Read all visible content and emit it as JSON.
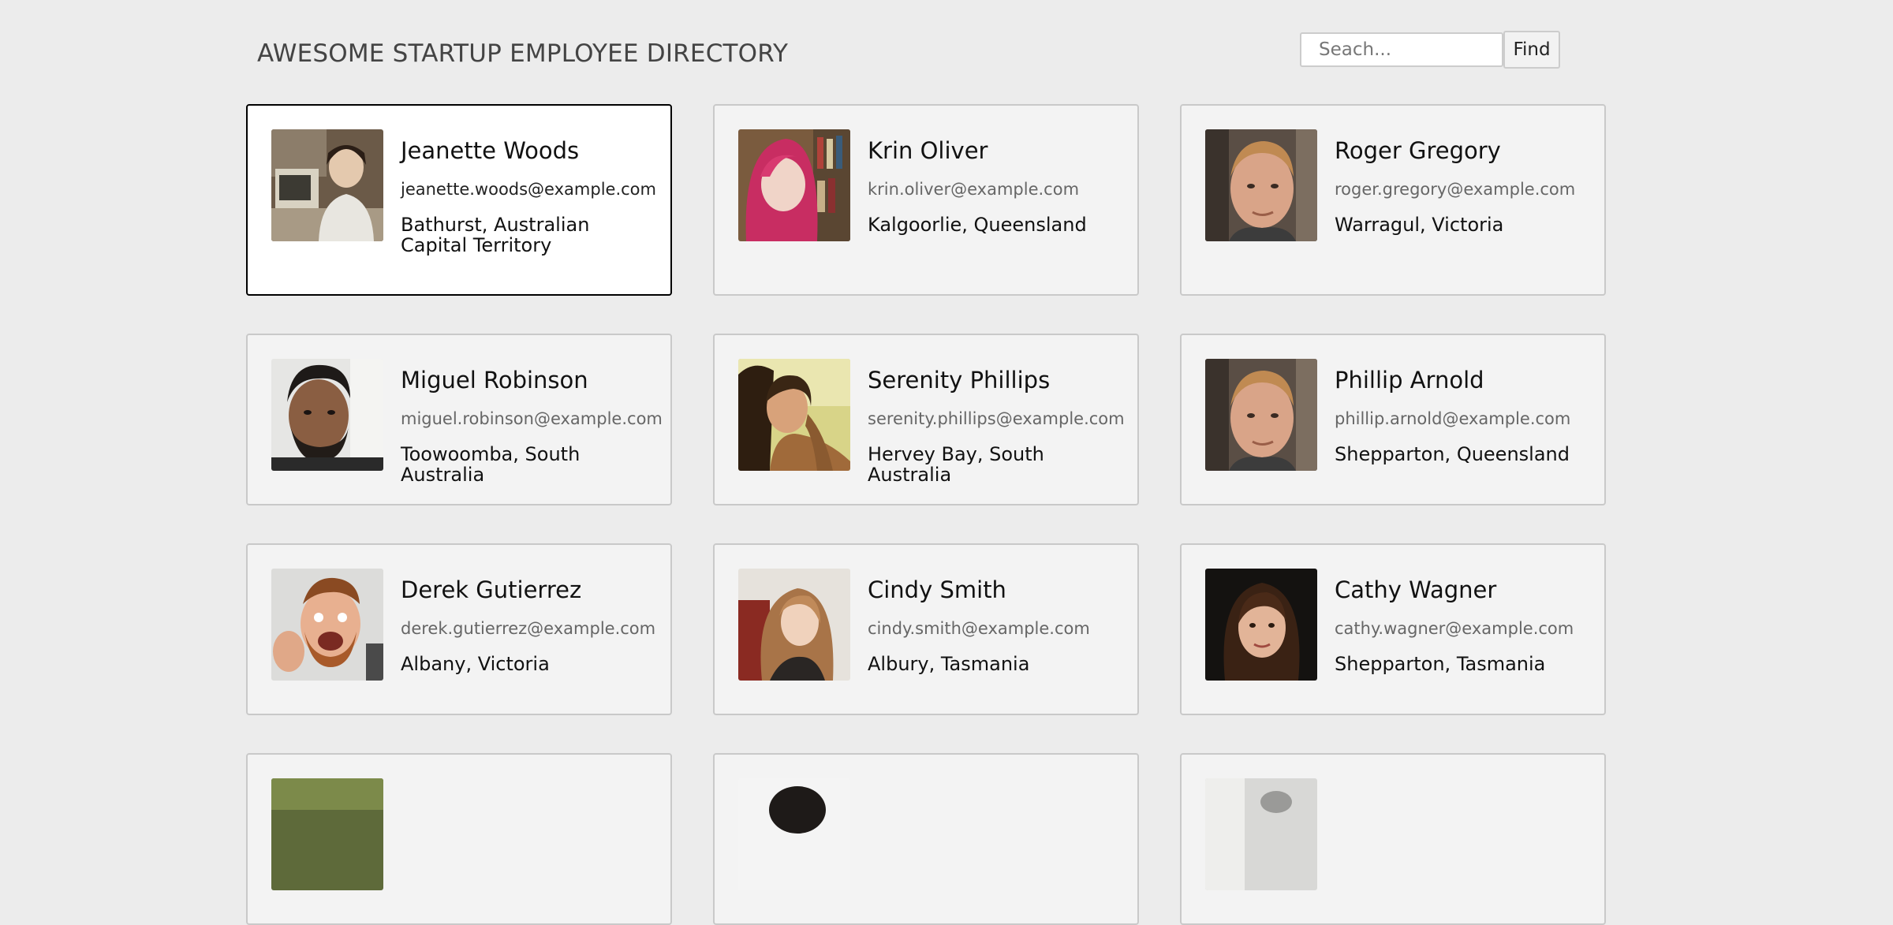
{
  "header": {
    "title": "AWESOME STARTUP EMPLOYEE DIRECTORY",
    "search_placeholder": "Seach...",
    "search_button": "Find"
  },
  "employees": [
    {
      "name": "Jeanette Woods",
      "email": "jeanette.woods@example.com",
      "location": "Bathurst, Australian Capital Territory",
      "selected": true
    },
    {
      "name": "Krin Oliver",
      "email": "krin.oliver@example.com",
      "location": "Kalgoorlie, Queensland"
    },
    {
      "name": "Roger Gregory",
      "email": "roger.gregory@example.com",
      "location": "Warragul, Victoria"
    },
    {
      "name": "Miguel Robinson",
      "email": "miguel.robinson@example.com",
      "location": "Toowoomba, South Australia"
    },
    {
      "name": "Serenity Phillips",
      "email": "serenity.phillips@example.com",
      "location": "Hervey Bay, South Australia"
    },
    {
      "name": "Phillip Arnold",
      "email": "phillip.arnold@example.com",
      "location": "Shepparton, Queensland"
    },
    {
      "name": "Derek Gutierrez",
      "email": "derek.gutierrez@example.com",
      "location": "Albany, Victoria"
    },
    {
      "name": "Cindy Smith",
      "email": "cindy.smith@example.com",
      "location": "Albury, Tasmania"
    },
    {
      "name": "Cathy Wagner",
      "email": "cathy.wagner@example.com",
      "location": "Shepparton, Tasmania"
    }
  ]
}
